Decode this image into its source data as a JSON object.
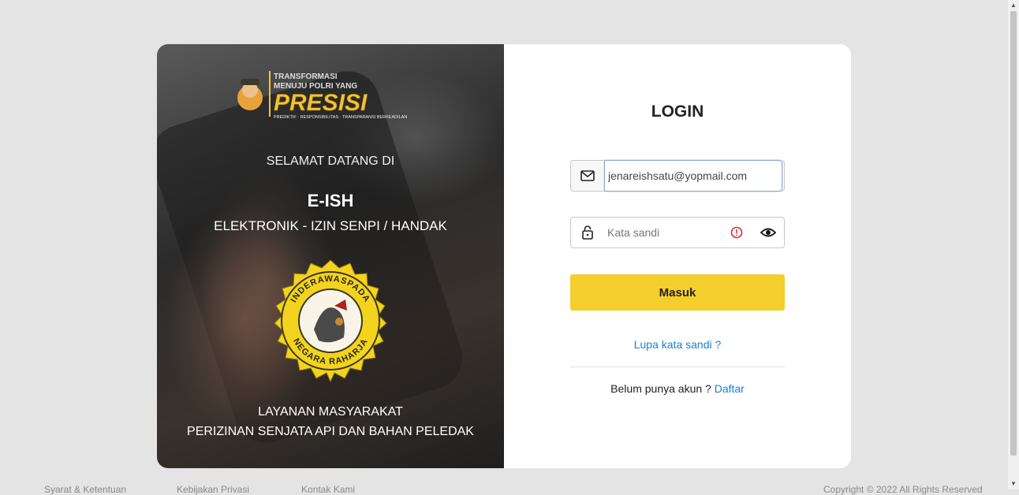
{
  "branding": {
    "logo_line1": "TRANSFORMASI",
    "logo_line2": "MENUJU POLRI YANG",
    "logo_word": "PRESISI",
    "logo_tagline": "PREDIKTIF · RESPONSIBILITAS · TRANSPARANSI BERKEADILAN",
    "welcome": "SELAMAT DATANG DI",
    "app_name": "E-ISH",
    "app_subtitle": "ELEKTRONIK - IZIN SENPI / HANDAK",
    "emblem_top_text": "INDERAWASPADA",
    "emblem_bottom_text": "NEGARA RAHARJA",
    "service_line1": "LAYANAN MASYARAKAT",
    "service_line2": "PERIZINAN SENJATA API DAN BAHAN PELEDAK"
  },
  "login": {
    "title": "LOGIN",
    "email_value": "jenareishsatu@yopmail.com",
    "password_placeholder": "Kata sandi",
    "submit_label": "Masuk",
    "forgot_label": "Lupa kata sandi ?",
    "signup_prompt": "Belum punya akun ?",
    "signup_link": "Daftar"
  },
  "footer": {
    "link1": "Syarat & Ketentuan",
    "link2": "Kebijakan Privasi",
    "link3": "Kontak Kami",
    "copyright": "Copyright © 2022 All Rights Reserved"
  },
  "colors": {
    "accent_yellow": "#f4ce2d",
    "link_blue": "#1a7fd4",
    "page_bg": "#e4e4e4",
    "warning_red": "#d32f2f"
  },
  "icons": {
    "email": "mail-icon",
    "password": "lock-icon",
    "warning": "warning-icon",
    "visibility": "eye-icon"
  }
}
